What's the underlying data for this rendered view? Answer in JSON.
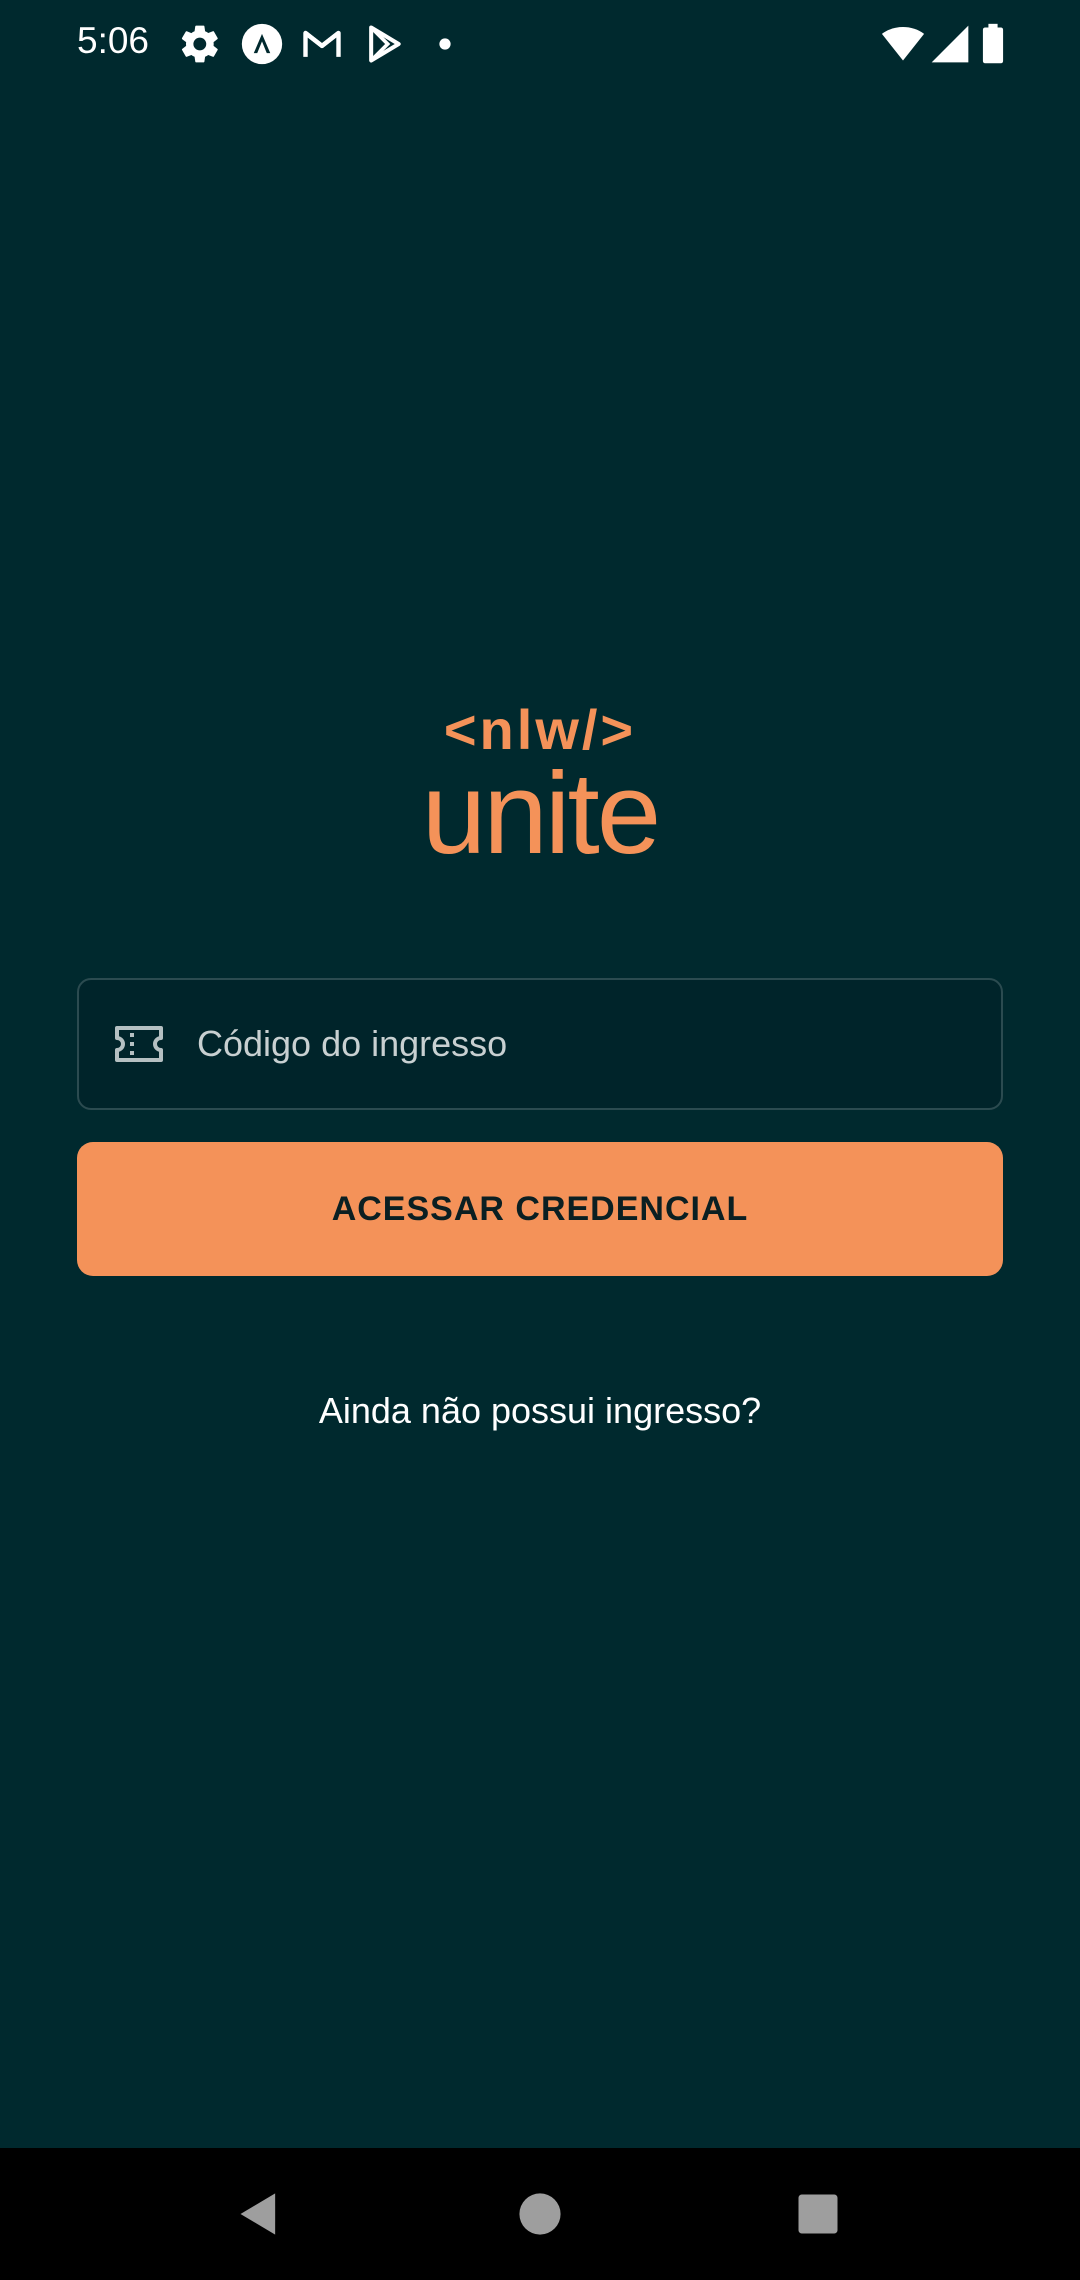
{
  "status_bar": {
    "time": "5:06",
    "icons": [
      "settings-icon",
      "app-a-icon",
      "gmail-icon",
      "play-store-icon",
      "notification-dot-icon",
      "wifi-icon",
      "signal-icon",
      "battery-icon"
    ]
  },
  "logo": {
    "top_text": "<nlw/>",
    "bottom_text": "unite"
  },
  "ticket_input": {
    "placeholder": "Código do ingresso",
    "value": "",
    "icon": "ticket-icon"
  },
  "access_button": {
    "label": "ACESSAR CREDENCIAL"
  },
  "no_ticket_link": {
    "label": "Ainda não possui ingresso?"
  },
  "nav_bar": {
    "icons": [
      "back-icon",
      "home-icon",
      "recents-icon"
    ]
  },
  "colors": {
    "background": "#00292E",
    "accent": "#F49259",
    "input_border": "#2B4B50"
  }
}
